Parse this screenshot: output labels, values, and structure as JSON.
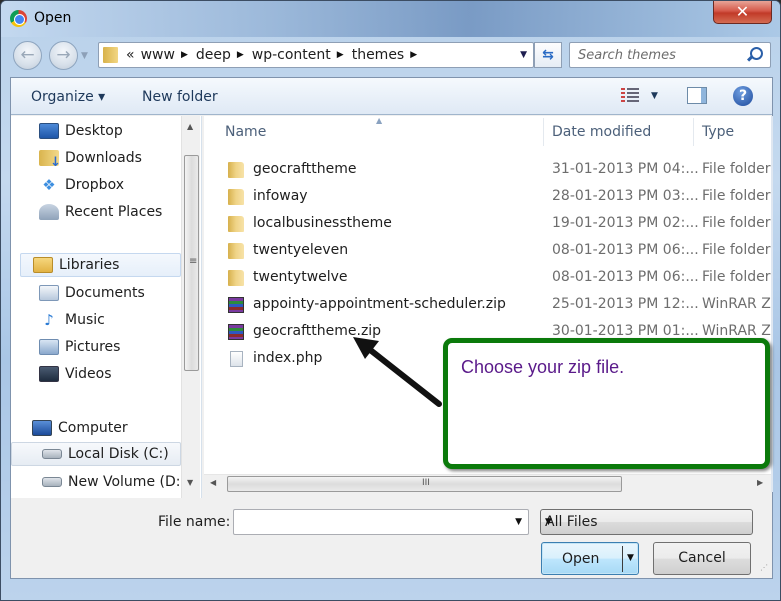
{
  "window": {
    "title": "Open",
    "close_label": "✕"
  },
  "navigation": {
    "back_glyph": "←",
    "forward_glyph": "→",
    "history_dropdown_glyph": "▼",
    "breadcrumb_overflow": "«",
    "breadcrumb": [
      "www",
      "deep",
      "wp-content",
      "themes"
    ],
    "breadcrumb_separator": "▶",
    "address_dropdown_glyph": "▼",
    "refresh_glyph": "⇆"
  },
  "search": {
    "placeholder": "Search themes",
    "value": ""
  },
  "toolbar": {
    "organize_label": "Organize ▾",
    "new_folder_label": "New folder",
    "view_dropdown_glyph": "▼",
    "help_glyph": "?"
  },
  "nav_pane": {
    "favorites": [
      {
        "label": "Desktop",
        "icon": "desktop-icon"
      },
      {
        "label": "Downloads",
        "icon": "downloads-icon"
      },
      {
        "label": "Dropbox",
        "icon": "dropbox-icon"
      },
      {
        "label": "Recent Places",
        "icon": "recent-places-icon"
      }
    ],
    "libraries": {
      "label": "Libraries",
      "items": [
        {
          "label": "Documents",
          "icon": "documents-icon"
        },
        {
          "label": "Music",
          "icon": "music-icon"
        },
        {
          "label": "Pictures",
          "icon": "pictures-icon"
        },
        {
          "label": "Videos",
          "icon": "videos-icon"
        }
      ]
    },
    "computer": {
      "label": "Computer",
      "items": [
        {
          "label": "Local Disk (C:)",
          "icon": "local-disk-icon",
          "selected": true
        },
        {
          "label": "New Volume (D:)",
          "icon": "volume-icon"
        }
      ]
    },
    "scroll_up_glyph": "▲",
    "scroll_down_glyph": "▼",
    "scroll_grip_glyph": "≡"
  },
  "file_list": {
    "columns": {
      "name": "Name",
      "date": "Date modified",
      "type": "Type"
    },
    "sort_glyph": "▲",
    "rows": [
      {
        "name": "geocrafttheme",
        "date": "31-01-2013 PM 04:...",
        "type": "File folder",
        "kind": "folder"
      },
      {
        "name": "infoway",
        "date": "28-01-2013 PM 03:...",
        "type": "File folder",
        "kind": "folder"
      },
      {
        "name": "localbusinesstheme",
        "date": "19-01-2013 PM 02:...",
        "type": "File folder",
        "kind": "folder"
      },
      {
        "name": "twentyeleven",
        "date": "08-01-2013 PM 06:...",
        "type": "File folder",
        "kind": "folder"
      },
      {
        "name": "twentytwelve",
        "date": "08-01-2013 PM 06:...",
        "type": "File folder",
        "kind": "folder"
      },
      {
        "name": "appointy-appointment-scheduler.zip",
        "date": "25-01-2013 PM 12:...",
        "type": "WinRAR ZI",
        "kind": "zip"
      },
      {
        "name": "geocrafttheme.zip",
        "date": "30-01-2013 PM 01:...",
        "type": "WinRAR ZI",
        "kind": "zip"
      },
      {
        "name": "index.php",
        "date": "",
        "type": "",
        "kind": "php"
      }
    ],
    "hscroll_left_glyph": "◀",
    "hscroll_right_glyph": "▶",
    "hscroll_grip_glyph": "III"
  },
  "footer": {
    "file_name_label": "File name:",
    "file_name_value": "",
    "file_name_dropdown_glyph": "▼",
    "file_type_selected": "All Files",
    "file_type_dropdown_glyph": "▼",
    "open_label": "Open",
    "open_dropdown_glyph": "▼",
    "cancel_label": "Cancel"
  },
  "annotation": {
    "callout_text": "Choose your zip file.",
    "callout_border_color": "#0b7a0b",
    "callout_text_color": "#5a1a8a",
    "arrow_color": "#111111"
  }
}
